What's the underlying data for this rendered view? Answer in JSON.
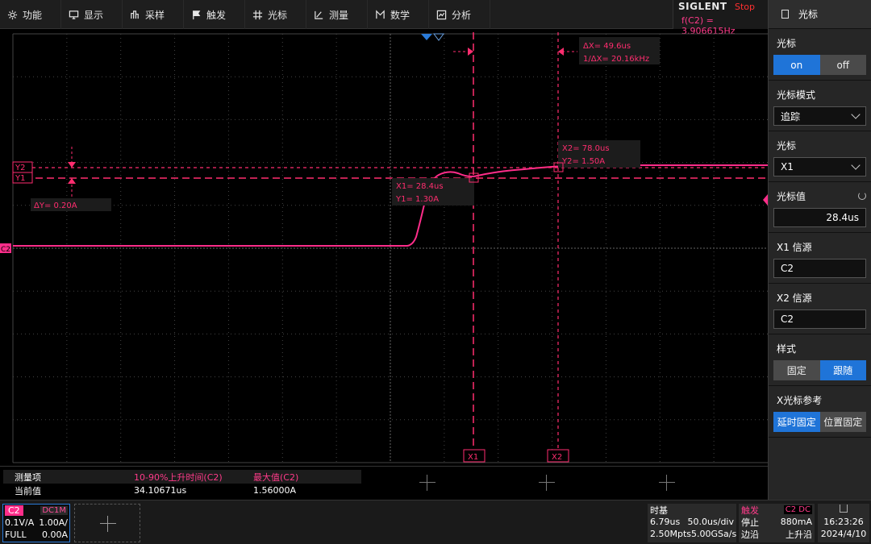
{
  "menu": [
    {
      "label": "功能",
      "icon": "gear-icon"
    },
    {
      "label": "显示",
      "icon": "monitor-icon"
    },
    {
      "label": "采样",
      "icon": "sample-icon"
    },
    {
      "label": "触发",
      "icon": "flag-icon"
    },
    {
      "label": "光标",
      "icon": "crosshair-icon"
    },
    {
      "label": "测量",
      "icon": "ruler-icon"
    },
    {
      "label": "数学",
      "icon": "math-icon"
    },
    {
      "label": "分析",
      "icon": "analysis-icon"
    }
  ],
  "status": {
    "brand": "SIGLENT",
    "run_state": "Stop",
    "frequency": "f(C2) = 3.906615Hz"
  },
  "panel": {
    "title": "光标",
    "cursor_label": "光标",
    "cursor_on": "on",
    "cursor_off": "off",
    "mode_label": "光标模式",
    "mode_value": "追踪",
    "select_label": "光标",
    "select_value": "X1",
    "value_label": "光标值",
    "value_value": "28.4us",
    "x1_src_label": "X1 信源",
    "x1_src_value": "C2",
    "x2_src_label": "X2 信源",
    "x2_src_value": "C2",
    "style_label": "样式",
    "style_fixed": "固定",
    "style_follow": "跟随",
    "xref_label": "X光标参考",
    "xref_delay": "延时固定",
    "xref_pos": "位置固定"
  },
  "waveform": {
    "color": "#ff2d8a",
    "cursor_color": "#ff2d6f",
    "channel_marker": "C2",
    "y2_label": "Y2",
    "y1_label": "Y1",
    "x1_label": "X1",
    "x2_label": "X2",
    "delta_x": "ΔX= 49.6us",
    "inv_delta_x": "1/ΔX= 20.16kHz",
    "delta_y": "ΔY= 0.20A",
    "x1_time": "X1= 28.4us",
    "y1_value": "Y1= 1.30A",
    "x2_time": "X2= 78.0us",
    "y2_value": "Y2= 1.50A"
  },
  "measurements": {
    "header": [
      "测量项",
      "10-90%上升时间(C2)",
      "最大值(C2)"
    ],
    "row": [
      "当前值",
      "34.10671us",
      "1.56000A"
    ]
  },
  "channel": {
    "name": "C2",
    "coupling": "DC1M",
    "scale": "0.1V/A",
    "probe": "1.00A/",
    "bw": "FULL",
    "offset": "0.00A"
  },
  "timebase": {
    "title": "时基",
    "delay": "6.79us",
    "scale": "50.0us/div",
    "mpts": "2.50Mpts",
    "rate": "5.00GSa/s"
  },
  "trigger": {
    "title": "触发",
    "source": "C2 DC",
    "state": "停止",
    "level": "880mA",
    "type": "边沿",
    "slope": "上升沿"
  },
  "clock": {
    "time": "16:23:26",
    "date": "2024/4/10"
  }
}
